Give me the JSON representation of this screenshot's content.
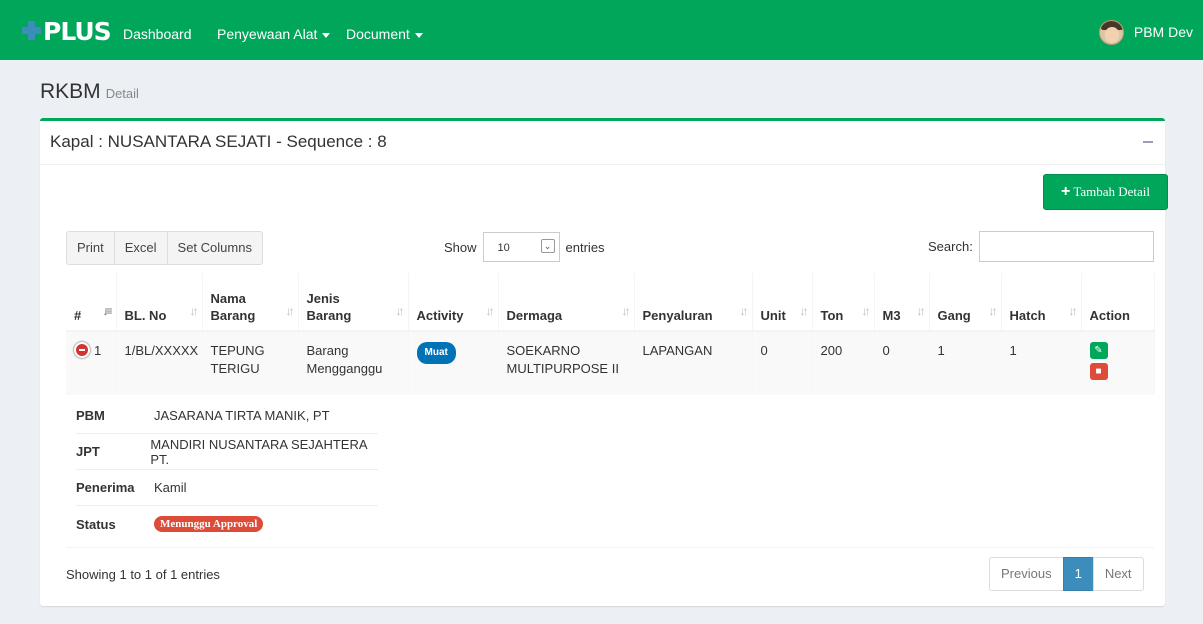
{
  "navbar": {
    "logo": "PLUS",
    "items": [
      {
        "label": "Dashboard"
      },
      {
        "label": "Penyewaan Alat"
      },
      {
        "label": "Document"
      }
    ],
    "user_name": "PBM Dev"
  },
  "page": {
    "title": "RKBM",
    "subtitle": "Detail"
  },
  "box": {
    "title": "Kapal : NUSANTARA SEJATI - Sequence : 8",
    "add_button": "Tambah Detail"
  },
  "table_tools": {
    "buttons": [
      "Print",
      "Excel",
      "Set Columns"
    ],
    "show_label": "Show",
    "entries_value": "10",
    "entries_label": "entries",
    "search_label": "Search:"
  },
  "table": {
    "headers": [
      "#",
      "BL. No",
      "Nama Barang",
      "Jenis Barang",
      "Activity",
      "Dermaga",
      "Penyaluran",
      "Unit",
      "Ton",
      "M3",
      "Gang",
      "Hatch",
      "Action"
    ],
    "rows": [
      {
        "no": "1",
        "bl_no": "1/BL/XXXXX",
        "nama_barang": "TEPUNG TERIGU",
        "jenis_barang": "Barang Mengganggu",
        "activity": "Muat",
        "dermaga": "SOEKARNO MULTIPURPOSE II",
        "penyaluran": "LAPANGAN",
        "unit": "0",
        "ton": "200",
        "m3": "0",
        "gang": "1",
        "hatch": "1"
      }
    ]
  },
  "details": [
    {
      "key": "PBM",
      "value": "JASARANA TIRTA MANIK, PT"
    },
    {
      "key": "JPT",
      "value": "MANDIRI NUSANTARA SEJAHTERA PT."
    },
    {
      "key": "Penerima",
      "value": "Kamil"
    },
    {
      "key": "Status",
      "value": "Menunggu Approval"
    }
  ],
  "footer": {
    "info": "Showing 1 to 1 of 1 entries",
    "previous": "Previous",
    "page": "1",
    "next": "Next"
  },
  "colors": {
    "brand_green": "#00a65a",
    "primary_blue": "#3c8dbc",
    "danger_red": "#dd4b39"
  },
  "icons": [
    "plus-logo-icon",
    "caret-down-icon",
    "user-avatar-icon",
    "minus-icon",
    "plus-icon",
    "sort-icon",
    "collapse-row-icon",
    "edit-icon",
    "trash-icon"
  ]
}
